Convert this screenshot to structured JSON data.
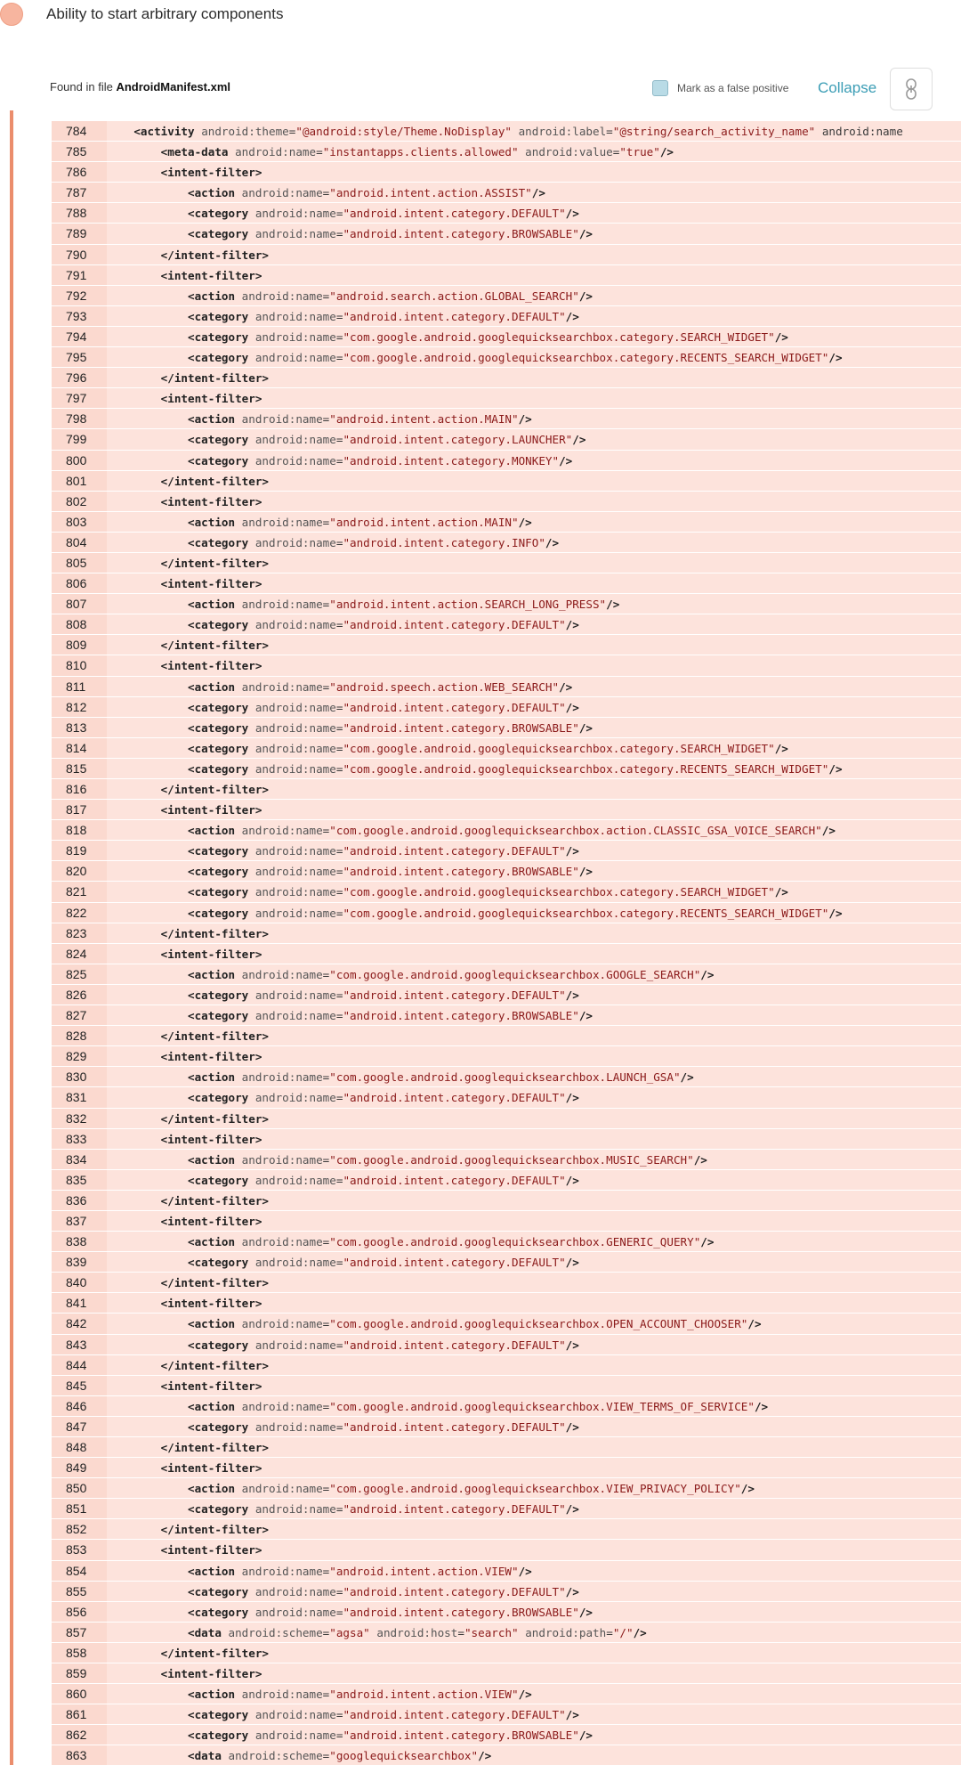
{
  "issue": {
    "title": "Ability to start arbitrary components",
    "severity_color": "#f7b59f"
  },
  "file_bar": {
    "found_prefix": "Found in file ",
    "file_name": "AndroidManifest.xml",
    "false_positive_label": "Mark as a false positive",
    "collapse_label": "Collapse",
    "link_icon": "link-icon"
  },
  "code": {
    "lines": [
      {
        "n": "784",
        "t": "    <activity android:theme=\"@android:style/Theme.NoDisplay\" android:label=\"@string/search_activity_name\" android:name"
      },
      {
        "n": "785",
        "t": "        <meta-data android:name=\"instantapps.clients.allowed\" android:value=\"true\"/>"
      },
      {
        "n": "786",
        "t": "        <intent-filter>"
      },
      {
        "n": "787",
        "t": "            <action android:name=\"android.intent.action.ASSIST\"/>"
      },
      {
        "n": "788",
        "t": "            <category android:name=\"android.intent.category.DEFAULT\"/>"
      },
      {
        "n": "789",
        "t": "            <category android:name=\"android.intent.category.BROWSABLE\"/>"
      },
      {
        "n": "790",
        "t": "        </intent-filter>"
      },
      {
        "n": "791",
        "t": "        <intent-filter>"
      },
      {
        "n": "792",
        "t": "            <action android:name=\"android.search.action.GLOBAL_SEARCH\"/>"
      },
      {
        "n": "793",
        "t": "            <category android:name=\"android.intent.category.DEFAULT\"/>"
      },
      {
        "n": "794",
        "t": "            <category android:name=\"com.google.android.googlequicksearchbox.category.SEARCH_WIDGET\"/>"
      },
      {
        "n": "795",
        "t": "            <category android:name=\"com.google.android.googlequicksearchbox.category.RECENTS_SEARCH_WIDGET\"/>"
      },
      {
        "n": "796",
        "t": "        </intent-filter>"
      },
      {
        "n": "797",
        "t": "        <intent-filter>"
      },
      {
        "n": "798",
        "t": "            <action android:name=\"android.intent.action.MAIN\"/>"
      },
      {
        "n": "799",
        "t": "            <category android:name=\"android.intent.category.LAUNCHER\"/>"
      },
      {
        "n": "800",
        "t": "            <category android:name=\"android.intent.category.MONKEY\"/>"
      },
      {
        "n": "801",
        "t": "        </intent-filter>"
      },
      {
        "n": "802",
        "t": "        <intent-filter>"
      },
      {
        "n": "803",
        "t": "            <action android:name=\"android.intent.action.MAIN\"/>"
      },
      {
        "n": "804",
        "t": "            <category android:name=\"android.intent.category.INFO\"/>"
      },
      {
        "n": "805",
        "t": "        </intent-filter>"
      },
      {
        "n": "806",
        "t": "        <intent-filter>"
      },
      {
        "n": "807",
        "t": "            <action android:name=\"android.intent.action.SEARCH_LONG_PRESS\"/>"
      },
      {
        "n": "808",
        "t": "            <category android:name=\"android.intent.category.DEFAULT\"/>"
      },
      {
        "n": "809",
        "t": "        </intent-filter>"
      },
      {
        "n": "810",
        "t": "        <intent-filter>"
      },
      {
        "n": "811",
        "t": "            <action android:name=\"android.speech.action.WEB_SEARCH\"/>"
      },
      {
        "n": "812",
        "t": "            <category android:name=\"android.intent.category.DEFAULT\"/>"
      },
      {
        "n": "813",
        "t": "            <category android:name=\"android.intent.category.BROWSABLE\"/>"
      },
      {
        "n": "814",
        "t": "            <category android:name=\"com.google.android.googlequicksearchbox.category.SEARCH_WIDGET\"/>"
      },
      {
        "n": "815",
        "t": "            <category android:name=\"com.google.android.googlequicksearchbox.category.RECENTS_SEARCH_WIDGET\"/>"
      },
      {
        "n": "816",
        "t": "        </intent-filter>"
      },
      {
        "n": "817",
        "t": "        <intent-filter>"
      },
      {
        "n": "818",
        "t": "            <action android:name=\"com.google.android.googlequicksearchbox.action.CLASSIC_GSA_VOICE_SEARCH\"/>"
      },
      {
        "n": "819",
        "t": "            <category android:name=\"android.intent.category.DEFAULT\"/>"
      },
      {
        "n": "820",
        "t": "            <category android:name=\"android.intent.category.BROWSABLE\"/>"
      },
      {
        "n": "821",
        "t": "            <category android:name=\"com.google.android.googlequicksearchbox.category.SEARCH_WIDGET\"/>"
      },
      {
        "n": "822",
        "t": "            <category android:name=\"com.google.android.googlequicksearchbox.category.RECENTS_SEARCH_WIDGET\"/>"
      },
      {
        "n": "823",
        "t": "        </intent-filter>"
      },
      {
        "n": "824",
        "t": "        <intent-filter>"
      },
      {
        "n": "825",
        "t": "            <action android:name=\"com.google.android.googlequicksearchbox.GOOGLE_SEARCH\"/>"
      },
      {
        "n": "826",
        "t": "            <category android:name=\"android.intent.category.DEFAULT\"/>"
      },
      {
        "n": "827",
        "t": "            <category android:name=\"android.intent.category.BROWSABLE\"/>"
      },
      {
        "n": "828",
        "t": "        </intent-filter>"
      },
      {
        "n": "829",
        "t": "        <intent-filter>"
      },
      {
        "n": "830",
        "t": "            <action android:name=\"com.google.android.googlequicksearchbox.LAUNCH_GSA\"/>"
      },
      {
        "n": "831",
        "t": "            <category android:name=\"android.intent.category.DEFAULT\"/>"
      },
      {
        "n": "832",
        "t": "        </intent-filter>"
      },
      {
        "n": "833",
        "t": "        <intent-filter>"
      },
      {
        "n": "834",
        "t": "            <action android:name=\"com.google.android.googlequicksearchbox.MUSIC_SEARCH\"/>"
      },
      {
        "n": "835",
        "t": "            <category android:name=\"android.intent.category.DEFAULT\"/>"
      },
      {
        "n": "836",
        "t": "        </intent-filter>"
      },
      {
        "n": "837",
        "t": "        <intent-filter>"
      },
      {
        "n": "838",
        "t": "            <action android:name=\"com.google.android.googlequicksearchbox.GENERIC_QUERY\"/>"
      },
      {
        "n": "839",
        "t": "            <category android:name=\"android.intent.category.DEFAULT\"/>"
      },
      {
        "n": "840",
        "t": "        </intent-filter>"
      },
      {
        "n": "841",
        "t": "        <intent-filter>"
      },
      {
        "n": "842",
        "t": "            <action android:name=\"com.google.android.googlequicksearchbox.OPEN_ACCOUNT_CHOOSER\"/>"
      },
      {
        "n": "843",
        "t": "            <category android:name=\"android.intent.category.DEFAULT\"/>"
      },
      {
        "n": "844",
        "t": "        </intent-filter>"
      },
      {
        "n": "845",
        "t": "        <intent-filter>"
      },
      {
        "n": "846",
        "t": "            <action android:name=\"com.google.android.googlequicksearchbox.VIEW_TERMS_OF_SERVICE\"/>"
      },
      {
        "n": "847",
        "t": "            <category android:name=\"android.intent.category.DEFAULT\"/>"
      },
      {
        "n": "848",
        "t": "        </intent-filter>"
      },
      {
        "n": "849",
        "t": "        <intent-filter>"
      },
      {
        "n": "850",
        "t": "            <action android:name=\"com.google.android.googlequicksearchbox.VIEW_PRIVACY_POLICY\"/>"
      },
      {
        "n": "851",
        "t": "            <category android:name=\"android.intent.category.DEFAULT\"/>"
      },
      {
        "n": "852",
        "t": "        </intent-filter>"
      },
      {
        "n": "853",
        "t": "        <intent-filter>"
      },
      {
        "n": "854",
        "t": "            <action android:name=\"android.intent.action.VIEW\"/>"
      },
      {
        "n": "855",
        "t": "            <category android:name=\"android.intent.category.DEFAULT\"/>"
      },
      {
        "n": "856",
        "t": "            <category android:name=\"android.intent.category.BROWSABLE\"/>"
      },
      {
        "n": "857",
        "t": "            <data android:scheme=\"agsa\" android:host=\"search\" android:path=\"/\"/>"
      },
      {
        "n": "858",
        "t": "        </intent-filter>"
      },
      {
        "n": "859",
        "t": "        <intent-filter>"
      },
      {
        "n": "860",
        "t": "            <action android:name=\"android.intent.action.VIEW\"/>"
      },
      {
        "n": "861",
        "t": "            <category android:name=\"android.intent.category.DEFAULT\"/>"
      },
      {
        "n": "862",
        "t": "            <category android:name=\"android.intent.category.BROWSABLE\"/>"
      },
      {
        "n": "863",
        "t": "            <data android:scheme=\"googlequicksearchbox\"/>"
      }
    ]
  }
}
